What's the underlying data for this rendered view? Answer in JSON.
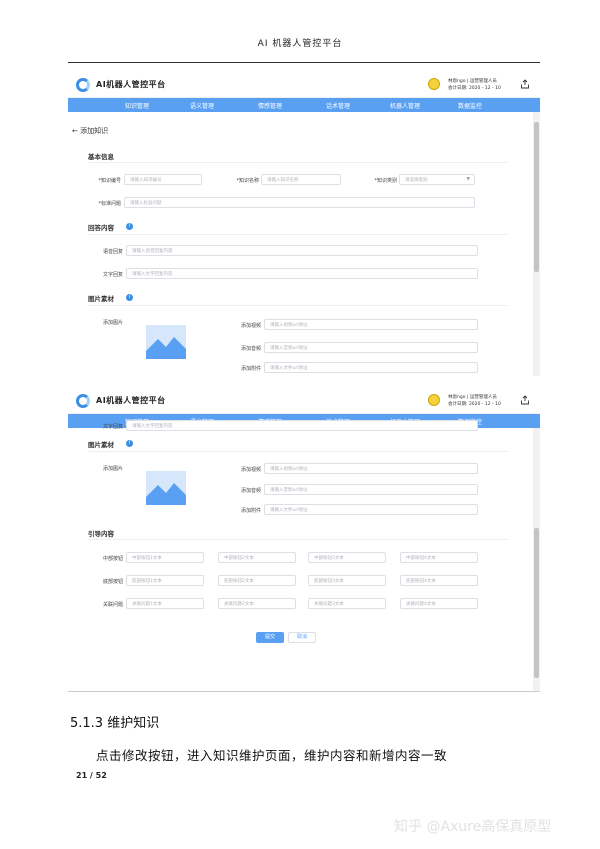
{
  "doc": {
    "header_title": "AI 机器人管控平台",
    "section_heading": "5.1.3  维护知识",
    "body_text": "点击修改按钮，进入知识维护页面，维护内容和新增内容一致",
    "page_number": "21 / 52",
    "watermark": "知乎 @Axure高保真原型"
  },
  "app": {
    "title": "AI机器人管控平台",
    "user_line1": "林恩ngo | 运营管理人员",
    "user_line2": "会计日期: 2020 - 12 - 10",
    "icons": {
      "logo": "logo-icon",
      "avatar": "avatar-icon",
      "export": "export-icon",
      "info": "info-icon"
    },
    "accent_color": "#5aa0f2",
    "nav": [
      "知识管理",
      "语义管理",
      "情感管理",
      "话术管理",
      "机器人管理",
      "数据监控"
    ]
  },
  "form": {
    "back_label": "← 添加知识",
    "basic_info": "基本信息",
    "fields": {
      "knowledge_id": {
        "label": "*知识编号",
        "placeholder": "请输入知识编号"
      },
      "knowledge_name": {
        "label": "*知识名称",
        "placeholder": "请输入知识名称"
      },
      "knowledge_category": {
        "label": "*知识类别",
        "value": "请选择类别"
      },
      "standard_question": {
        "label": "*标准问题",
        "placeholder": "请输入标准问题"
      }
    },
    "answer_section": "回答内容",
    "voice_answer": {
      "label": "语音回复",
      "placeholder": "请输入语音回复内容"
    },
    "text_answer": {
      "label": "文字回复",
      "placeholder": "请输入文字回复内容"
    },
    "text_answer_partial": "文字回复",
    "image_section": "图片素材",
    "add_image": "添加图片",
    "add_video": {
      "label": "添加视频",
      "placeholder": "请输入视频url地址"
    },
    "add_audio": {
      "label": "添加音频",
      "placeholder": "请输入音频url地址"
    },
    "add_file": {
      "label": "添加附件",
      "placeholder": "请输入文件url地址"
    },
    "guide_section": "引导内容",
    "middle_buttons": {
      "label": "中部按钮",
      "placeholders": [
        "中部按钮1文本",
        "中部按钮2文本",
        "中部按钮3文本",
        "中部按钮4文本"
      ]
    },
    "bottom_buttons": {
      "label": "底部按钮",
      "placeholders": [
        "底部按钮1文本",
        "底部按钮2文本",
        "底部按钮3文本",
        "底部按钮4文本"
      ]
    },
    "related_questions": {
      "label": "关联问题",
      "placeholders": [
        "关联问题1文本",
        "关联问题2文本",
        "关联问题3文本",
        "关联问题4文本"
      ]
    },
    "submit": "提交",
    "cancel": "取消"
  }
}
